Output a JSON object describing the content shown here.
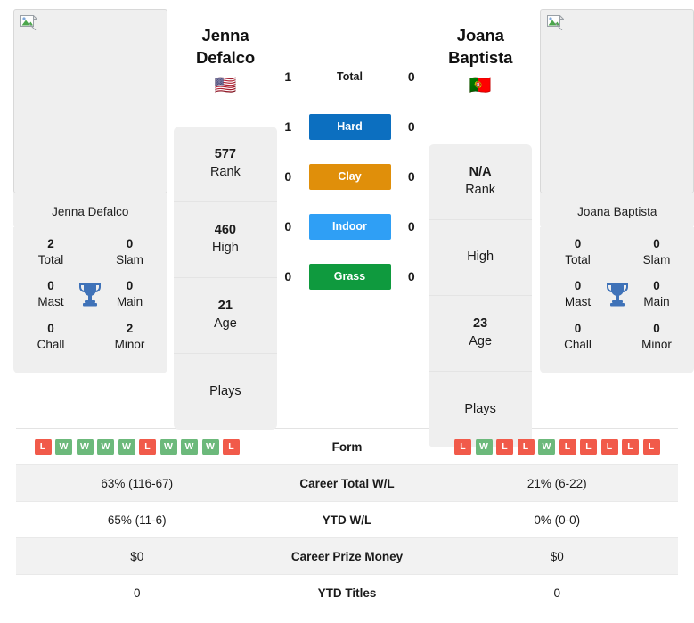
{
  "players": {
    "left": {
      "name_line1": "Jenna",
      "name_line2": "Defalco",
      "full_name": "Jenna Defalco",
      "flag": "🇺🇸",
      "flag_name": "united-states-flag",
      "photo_alt": "broken-image",
      "titles": {
        "total_value": "2",
        "total_label": "Total",
        "slam_value": "0",
        "slam_label": "Slam",
        "mast_value": "0",
        "mast_label": "Mast",
        "main_value": "0",
        "main_label": "Main",
        "chall_value": "0",
        "chall_label": "Chall",
        "minor_value": "2",
        "minor_label": "Minor"
      },
      "stats": [
        {
          "value": "577",
          "label": "Rank"
        },
        {
          "value": "460",
          "label": "High"
        },
        {
          "value": "21",
          "label": "Age"
        },
        {
          "value": "",
          "label": "Plays"
        }
      ],
      "form": [
        "L",
        "W",
        "W",
        "W",
        "W",
        "L",
        "W",
        "W",
        "W",
        "L"
      ]
    },
    "right": {
      "name_line1": "Joana",
      "name_line2": "Baptista",
      "full_name": "Joana Baptista",
      "flag": "🇵🇹",
      "flag_name": "portugal-flag",
      "photo_alt": "broken-image",
      "titles": {
        "total_value": "0",
        "total_label": "Total",
        "slam_value": "0",
        "slam_label": "Slam",
        "mast_value": "0",
        "mast_label": "Mast",
        "main_value": "0",
        "main_label": "Main",
        "chall_value": "0",
        "chall_label": "Chall",
        "minor_value": "0",
        "minor_label": "Minor"
      },
      "stats": [
        {
          "value": "N/A",
          "label": "Rank"
        },
        {
          "value": "",
          "label": "High"
        },
        {
          "value": "23",
          "label": "Age"
        },
        {
          "value": "",
          "label": "Plays"
        }
      ],
      "form": [
        "L",
        "W",
        "L",
        "L",
        "W",
        "L",
        "L",
        "L",
        "L",
        "L"
      ]
    }
  },
  "head_to_head": [
    {
      "label": "Total",
      "left": "1",
      "right": "0",
      "color": "transparent",
      "text_color": "#1a1a1a"
    },
    {
      "label": "Hard",
      "left": "1",
      "right": "0",
      "color": "#0c6fc0",
      "text_color": "#ffffff"
    },
    {
      "label": "Clay",
      "left": "0",
      "right": "0",
      "color": "#e08f0a",
      "text_color": "#ffffff"
    },
    {
      "label": "Indoor",
      "left": "0",
      "right": "0",
      "color": "#2f9ff5",
      "text_color": "#ffffff"
    },
    {
      "label": "Grass",
      "left": "0",
      "right": "0",
      "color": "#0f9a3e",
      "text_color": "#ffffff"
    }
  ],
  "table": {
    "rows": [
      {
        "label": "Form",
        "left": "",
        "right": "",
        "type": "form",
        "alt": false
      },
      {
        "label": "Career Total W/L",
        "left": "63% (116-67)",
        "right": "21% (6-22)",
        "type": "text",
        "alt": true
      },
      {
        "label": "YTD W/L",
        "left": "65% (11-6)",
        "right": "0% (0-0)",
        "type": "text",
        "alt": false
      },
      {
        "label": "Career Prize Money",
        "left": "$0",
        "right": "$0",
        "type": "text",
        "alt": true
      },
      {
        "label": "YTD Titles",
        "left": "0",
        "right": "0",
        "type": "text",
        "alt": false
      }
    ]
  },
  "colors": {
    "win_badge": "#6cb97b",
    "loss_badge": "#f15a4a",
    "card_bg": "#efefef",
    "stripe_bg": "#f2f2f2",
    "trophy": "#3f72b8"
  }
}
